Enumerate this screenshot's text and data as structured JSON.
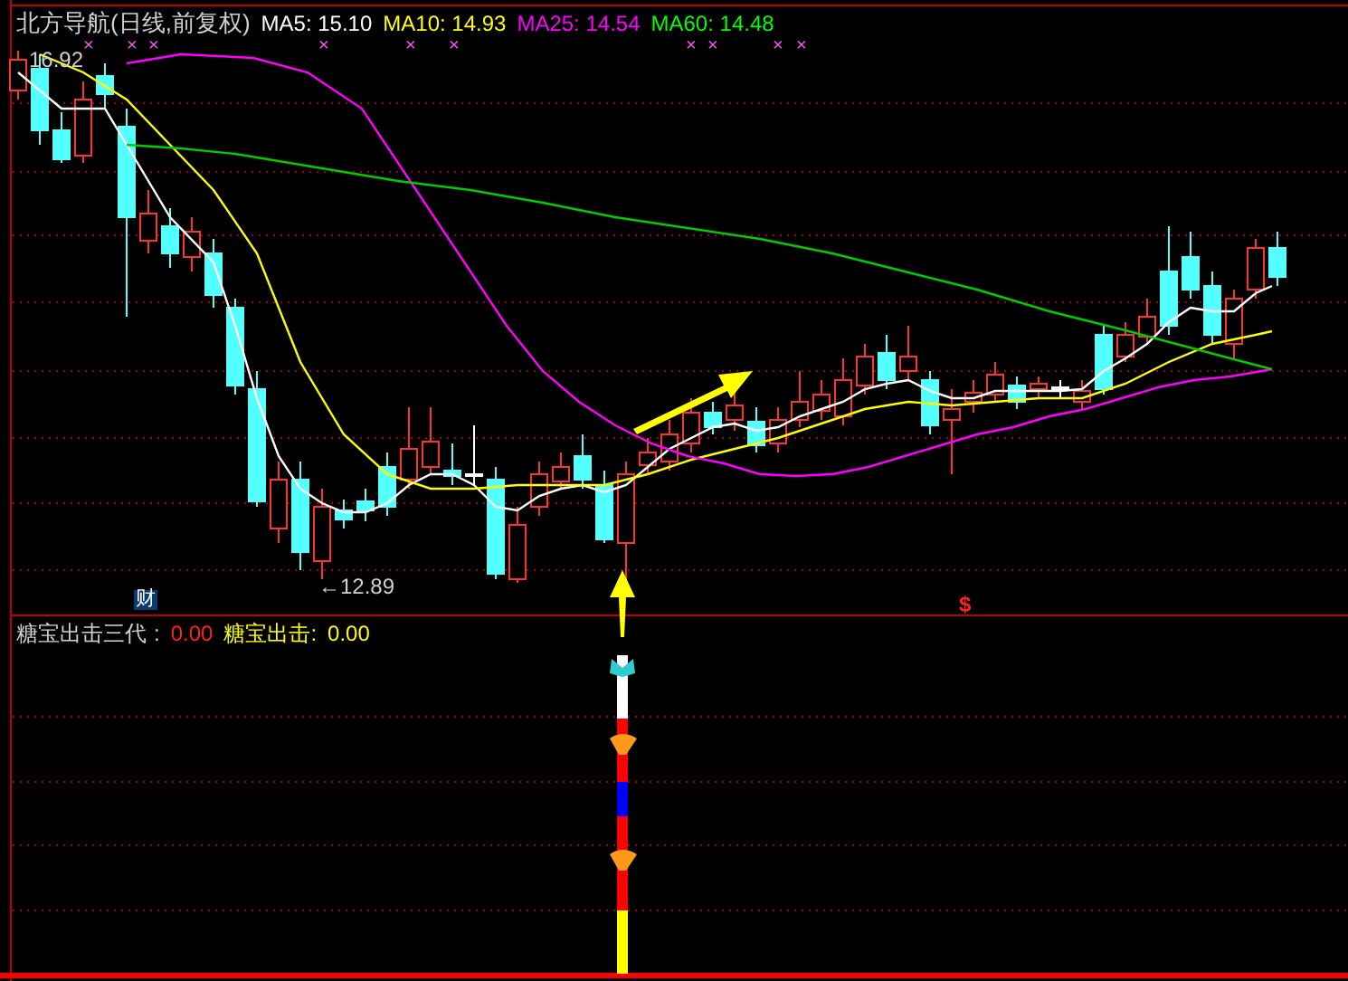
{
  "header": {
    "title": "北方导航(日线,前复权)",
    "averages": [
      {
        "label": "MA5:",
        "value": "15.10",
        "color": "#ffffff"
      },
      {
        "label": "MA10:",
        "value": "14.93",
        "color": "#ffff00"
      },
      {
        "label": "MA25:",
        "value": "14.54",
        "color": "#ff00ff"
      },
      {
        "label": "MA60:",
        "value": "14.48",
        "color": "#00ff00"
      }
    ]
  },
  "markers": [
    {
      "text": "×"
    },
    {
      "text": "×"
    },
    {
      "text": "×"
    },
    {
      "text": "×"
    },
    {
      "text": "×"
    },
    {
      "text": "×"
    },
    {
      "text": "×"
    },
    {
      "text": "×"
    },
    {
      "text": "×"
    },
    {
      "text": "×"
    }
  ],
  "high_label": "16.92",
  "low_label": "←12.89",
  "finance_badge": "财",
  "dollar_mark": "$",
  "indicator": {
    "name": "糖宝出击三代",
    "separator": ":",
    "value": "0.00",
    "signal_label": "糖宝出击:",
    "signal_value": "0.00"
  }
}
